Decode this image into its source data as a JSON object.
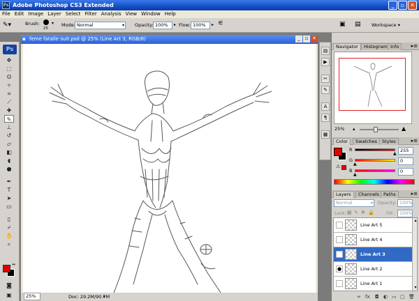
{
  "titlebar": {
    "app_title": "Adobe Photoshop CS3 Extended",
    "app_icon": "Ps"
  },
  "menus": [
    "File",
    "Edit",
    "Image",
    "Layer",
    "Select",
    "Filter",
    "Analysis",
    "View",
    "Window",
    "Help"
  ],
  "options": {
    "brush_label": "Brush:",
    "brush_size": "25",
    "mode_label": "Mode:",
    "mode_value": "Normal",
    "opacity_label": "Opacity:",
    "opacity_value": "100%",
    "flow_label": "Flow:",
    "flow_value": "100%",
    "workspace_label": "Workspace"
  },
  "toolbox": {
    "logo": "Ps"
  },
  "document": {
    "title": "feme fatalle suit.psd @ 25% (Line Art 3, RGB/8)",
    "zoom": "25%",
    "doc_info": "Doc: 29.2M/90.7M"
  },
  "navigator": {
    "tabs": [
      "Navigator",
      "Histogram",
      "Info"
    ],
    "zoom": "25%",
    "zoom_level": 0.4
  },
  "color_panel": {
    "tabs": [
      "Color",
      "Swatches",
      "Styles"
    ],
    "channels": [
      {
        "name": "R",
        "value": "255",
        "color": "#ff0000"
      },
      {
        "name": "G",
        "value": "0",
        "color": "#00ff00"
      },
      {
        "name": "B",
        "value": "0",
        "color": "#0000ff"
      }
    ],
    "foreground": "#e00000",
    "background": "#000000"
  },
  "layers_panel": {
    "tabs": [
      "Layers",
      "Channels",
      "Paths"
    ],
    "blend_mode": "Normal",
    "opacity_label": "Opacity:",
    "opacity_value": "100%",
    "lock_label": "Lock:",
    "fill_label": "Fill:",
    "fill_value": "100%",
    "layers": [
      {
        "name": "Line Art 5",
        "visible": false,
        "selected": false
      },
      {
        "name": "Line Art 4",
        "visible": false,
        "selected": false
      },
      {
        "name": "Line Art 3",
        "visible": false,
        "selected": true
      },
      {
        "name": "Line Art 2",
        "visible": true,
        "selected": false
      },
      {
        "name": "Line Art 1",
        "visible": false,
        "selected": false
      }
    ]
  },
  "colors": {
    "accent": "#316ac5",
    "titlebar": "#1550c8",
    "chrome": "#d6d3ce"
  }
}
